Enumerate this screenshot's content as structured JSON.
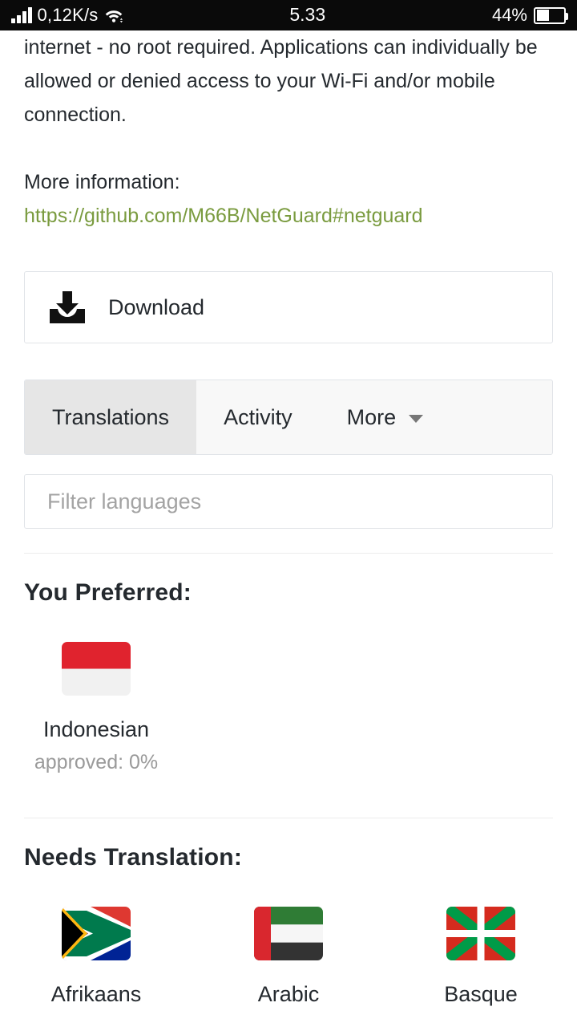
{
  "statusbar": {
    "network_speed": "0,12K/s",
    "time": "5.33",
    "battery_percent": "44%",
    "battery_level": 44,
    "signal_icon": "signal-bars-icon",
    "wifi_icon": "wifi-icon",
    "battery_icon": "battery-icon"
  },
  "article": {
    "paragraph": "internet - no root required. Applications can individually be allowed or denied access to your Wi-Fi and/or mobile connection.",
    "more_info_label": "More information:",
    "link_text": "https://github.com/M66B/NetGuard#netguard",
    "link_color": "#7a9b3f"
  },
  "download": {
    "label": "Download",
    "icon": "download-icon"
  },
  "tabs": {
    "items": [
      {
        "label": "Translations",
        "active": true
      },
      {
        "label": "Activity",
        "active": false
      },
      {
        "label": "More",
        "active": false,
        "has_caret": true
      }
    ]
  },
  "filter": {
    "placeholder": "Filter languages",
    "value": ""
  },
  "preferred": {
    "title": "You Preferred:",
    "languages": [
      {
        "name": "Indonesian",
        "status": "approved: 0%",
        "flag": "flag-indonesia"
      }
    ]
  },
  "needs_translation": {
    "title": "Needs Translation:",
    "languages": [
      {
        "name": "Afrikaans",
        "flag": "flag-south-africa"
      },
      {
        "name": "Arabic",
        "flag": "flag-united-arab-emirates"
      },
      {
        "name": "Basque",
        "flag": "flag-basque-country"
      }
    ]
  },
  "colors": {
    "link": "#7a9b3f",
    "tab_active_bg": "#e6e6e6",
    "tab_bg": "#f8f8f8",
    "border": "#e1e4e8",
    "text": "#24292e",
    "muted": "#9a9a9a"
  }
}
